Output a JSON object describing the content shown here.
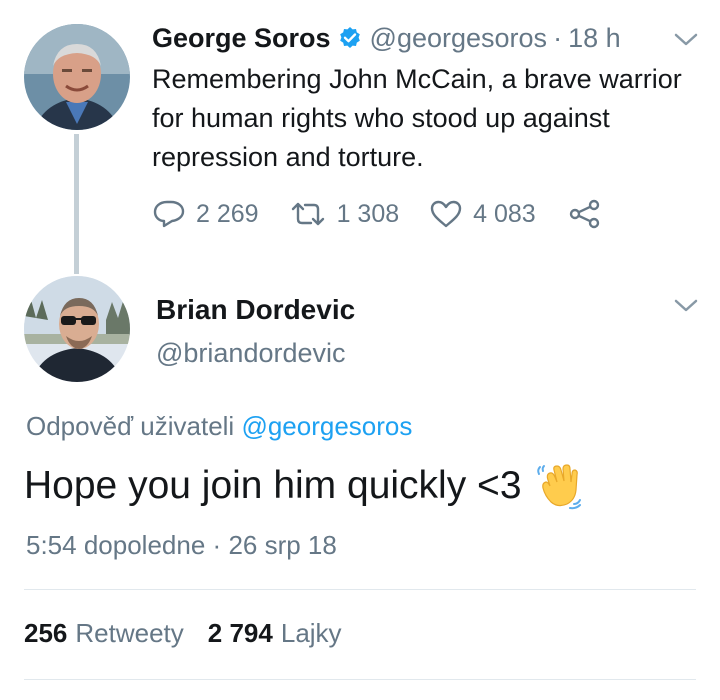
{
  "tweet1": {
    "author_name": "George Soros",
    "handle": "@georgesoros",
    "separator": "·",
    "time": "18 h",
    "text": "Remembering John McCain, a brave warrior for human rights who stood up against repression and torture.",
    "actions": {
      "replies": "2 269",
      "retweets": "1 308",
      "likes": "4 083"
    },
    "verified_color": "#1da1f2"
  },
  "tweet2": {
    "author_name": "Brian Dordevic",
    "handle": "@briandordevic",
    "replying_prefix": "Odpověď uživateli",
    "replying_mention": "@georgesoros",
    "text": "Hope you join him quickly <3",
    "emoji": "waving-hand",
    "time": "5:54 dopoledne",
    "separator": "·",
    "date": "26 srp 18",
    "retweet_count": "256",
    "retweet_label": "Retweety",
    "like_count": "2 794",
    "like_label": "Lajky"
  },
  "colors": {
    "text": "#14171a",
    "muted": "#657786",
    "accent": "#1da1f2",
    "thread_line": "#c4cfd6"
  }
}
